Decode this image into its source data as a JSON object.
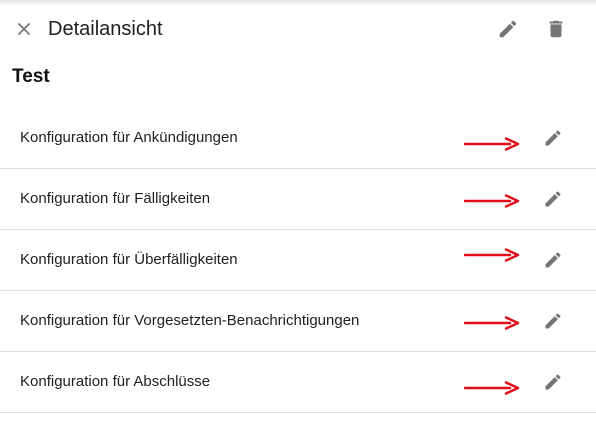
{
  "header": {
    "title": "Detailansicht",
    "close_icon": "close-icon",
    "edit_icon": "pencil-icon",
    "delete_icon": "trash-icon"
  },
  "section": {
    "title": "Test"
  },
  "rows": [
    {
      "label": "Konfiguration für Ankündigungen",
      "edit_icon": "pencil-icon"
    },
    {
      "label": "Konfiguration für Fälligkeiten",
      "edit_icon": "pencil-icon"
    },
    {
      "label": "Konfiguration für Überfälligkeiten",
      "edit_icon": "pencil-icon"
    },
    {
      "label": "Konfiguration für Vorgesetzten-Benachrichtigungen",
      "edit_icon": "pencil-icon"
    },
    {
      "label": "Konfiguration für Abschlüsse",
      "edit_icon": "pencil-icon"
    }
  ],
  "annotation": {
    "arrow_color": "#e0101a"
  },
  "colors": {
    "icon": "#757575",
    "divider": "#e0e0e0",
    "text": "#212121"
  }
}
